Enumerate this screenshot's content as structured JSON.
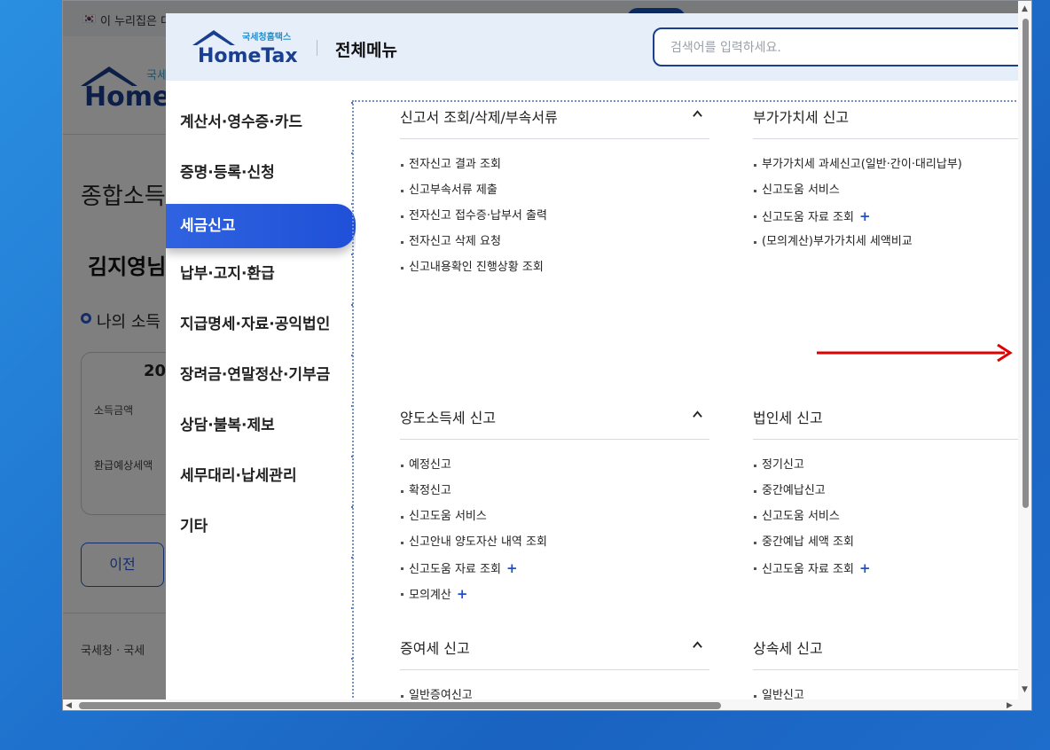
{
  "background_page": {
    "notice_text": "이 누리집은 대",
    "logo_small": "국세",
    "logo_big": "Home",
    "title": "종합소득",
    "user_name": "김지영님",
    "subtitle": "나의 소득",
    "card_year": "20",
    "card_label_1": "소득금액",
    "card_label_2": "환급예상세액",
    "prev_button": "이전",
    "footer_text": "국세청 · 국세"
  },
  "modal": {
    "logo_small": "국세청홈택스",
    "logo_big": "HomeTax",
    "title": "전체메뉴",
    "search_placeholder": "검색어를 입력하세요."
  },
  "sidebar": {
    "items": [
      {
        "label": "계산서·영수증·카드",
        "active": false
      },
      {
        "label": "증명·등록·신청",
        "active": false
      },
      {
        "label": "세금신고",
        "active": true
      },
      {
        "label": "납부·고지·환급",
        "active": false
      },
      {
        "label": "지급명세·자료·공익법인",
        "active": false
      },
      {
        "label": "장려금·연말정산·기부금",
        "active": false
      },
      {
        "label": "상담·불복·제보",
        "active": false
      },
      {
        "label": "세무대리·납세관리",
        "active": false
      },
      {
        "label": "기타",
        "active": false
      }
    ]
  },
  "sections": {
    "s1": {
      "title": "신고서 조회/삭제/부속서류",
      "items": [
        "전자신고 결과 조회",
        "신고부속서류 제출",
        "전자신고 접수증·납부서 출력",
        "전자신고 삭제 요청",
        "신고내용확인 진행상황 조회"
      ]
    },
    "s2": {
      "title": "부가가치세 신고",
      "items": [
        "부가가치세 과세신고(일반·간이·대리납부)",
        "신고도움 서비스",
        "신고도움 자료 조회",
        "(모의계산)부가가치세 세액비교"
      ]
    },
    "s3": {
      "title": "양도소득세 신고",
      "items": [
        "예정신고",
        "확정신고",
        "신고도움 서비스",
        "신고안내 양도자산 내역 조회",
        "신고도움 자료 조회",
        "모의계산"
      ]
    },
    "s4": {
      "title": "법인세 신고",
      "items": [
        "정기신고",
        "중간예납신고",
        "신고도움 서비스",
        "중간예납 세액 조회",
        "신고도움 자료 조회"
      ]
    },
    "s5": {
      "title": "증여세 신고",
      "items": [
        "일반증여신고"
      ]
    },
    "s6": {
      "title": "상속세 신고",
      "items": [
        "일반신고"
      ]
    },
    "plus_symbol": "+"
  },
  "colors": {
    "accent": "#1f50d8",
    "header_bg": "#e6eef9",
    "arrow": "#e00000"
  }
}
